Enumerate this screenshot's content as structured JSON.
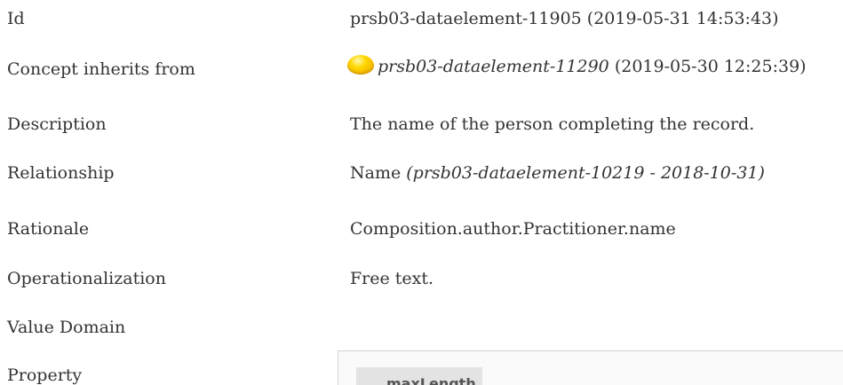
{
  "fields": [
    {
      "label": "Id",
      "value": "prsb03-dataelement-11905 (2019-05-31 14:53:43)"
    },
    {
      "label": "Concept inherits from",
      "value_link": "prsb03-dataelement-11290",
      "value_suffix": " (2019-05-30 12:25:39)",
      "icon": "yellow-status-circle-icon"
    },
    {
      "label": "Description",
      "value": "The name of the person completing the record."
    },
    {
      "label": "Relationship",
      "value_prefix": "Name ",
      "value_italic": "(prsb03-dataelement-10219 - 2018-10-31)"
    },
    {
      "label": "Rationale",
      "value": "Composition.author.Practitioner.name"
    },
    {
      "label": "Operationalization",
      "value": "Free text."
    },
    {
      "label": "Value Domain",
      "value": ""
    },
    {
      "label": "Property",
      "value": ""
    }
  ],
  "property_panel": {
    "chip_text": "maxLength"
  },
  "colors": {
    "text": "#333333",
    "status_icon": "#ffd700"
  }
}
